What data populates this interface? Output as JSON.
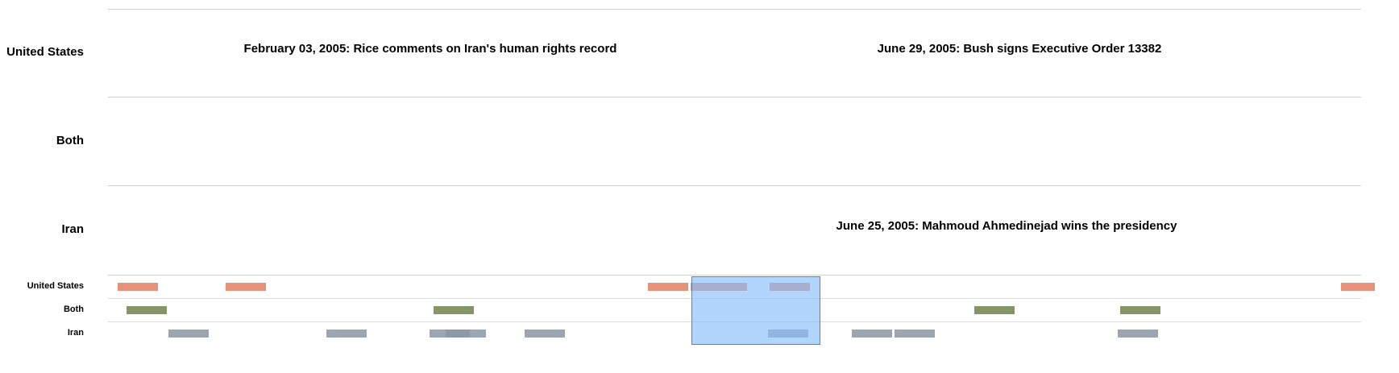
{
  "main_timeline": {
    "rows": [
      {
        "label": "United States"
      },
      {
        "label": "Both"
      },
      {
        "label": "Iran"
      }
    ],
    "events": [
      {
        "text": "February 03, 2005: Rice comments on Iran's human rights record"
      },
      {
        "text": "June 29, 2005: Bush signs Executive Order 13382"
      },
      {
        "text": "June 25, 2005: Mahmoud Ahmedinejad wins the presidency"
      }
    ]
  },
  "overview": {
    "rows": [
      {
        "label": "United States"
      },
      {
        "label": "Both"
      },
      {
        "label": "Iran"
      }
    ]
  },
  "colors": {
    "united_states": "#e27e62",
    "both": "#6e844e",
    "iran": "#8a96a5",
    "selection": "#87befa"
  }
}
